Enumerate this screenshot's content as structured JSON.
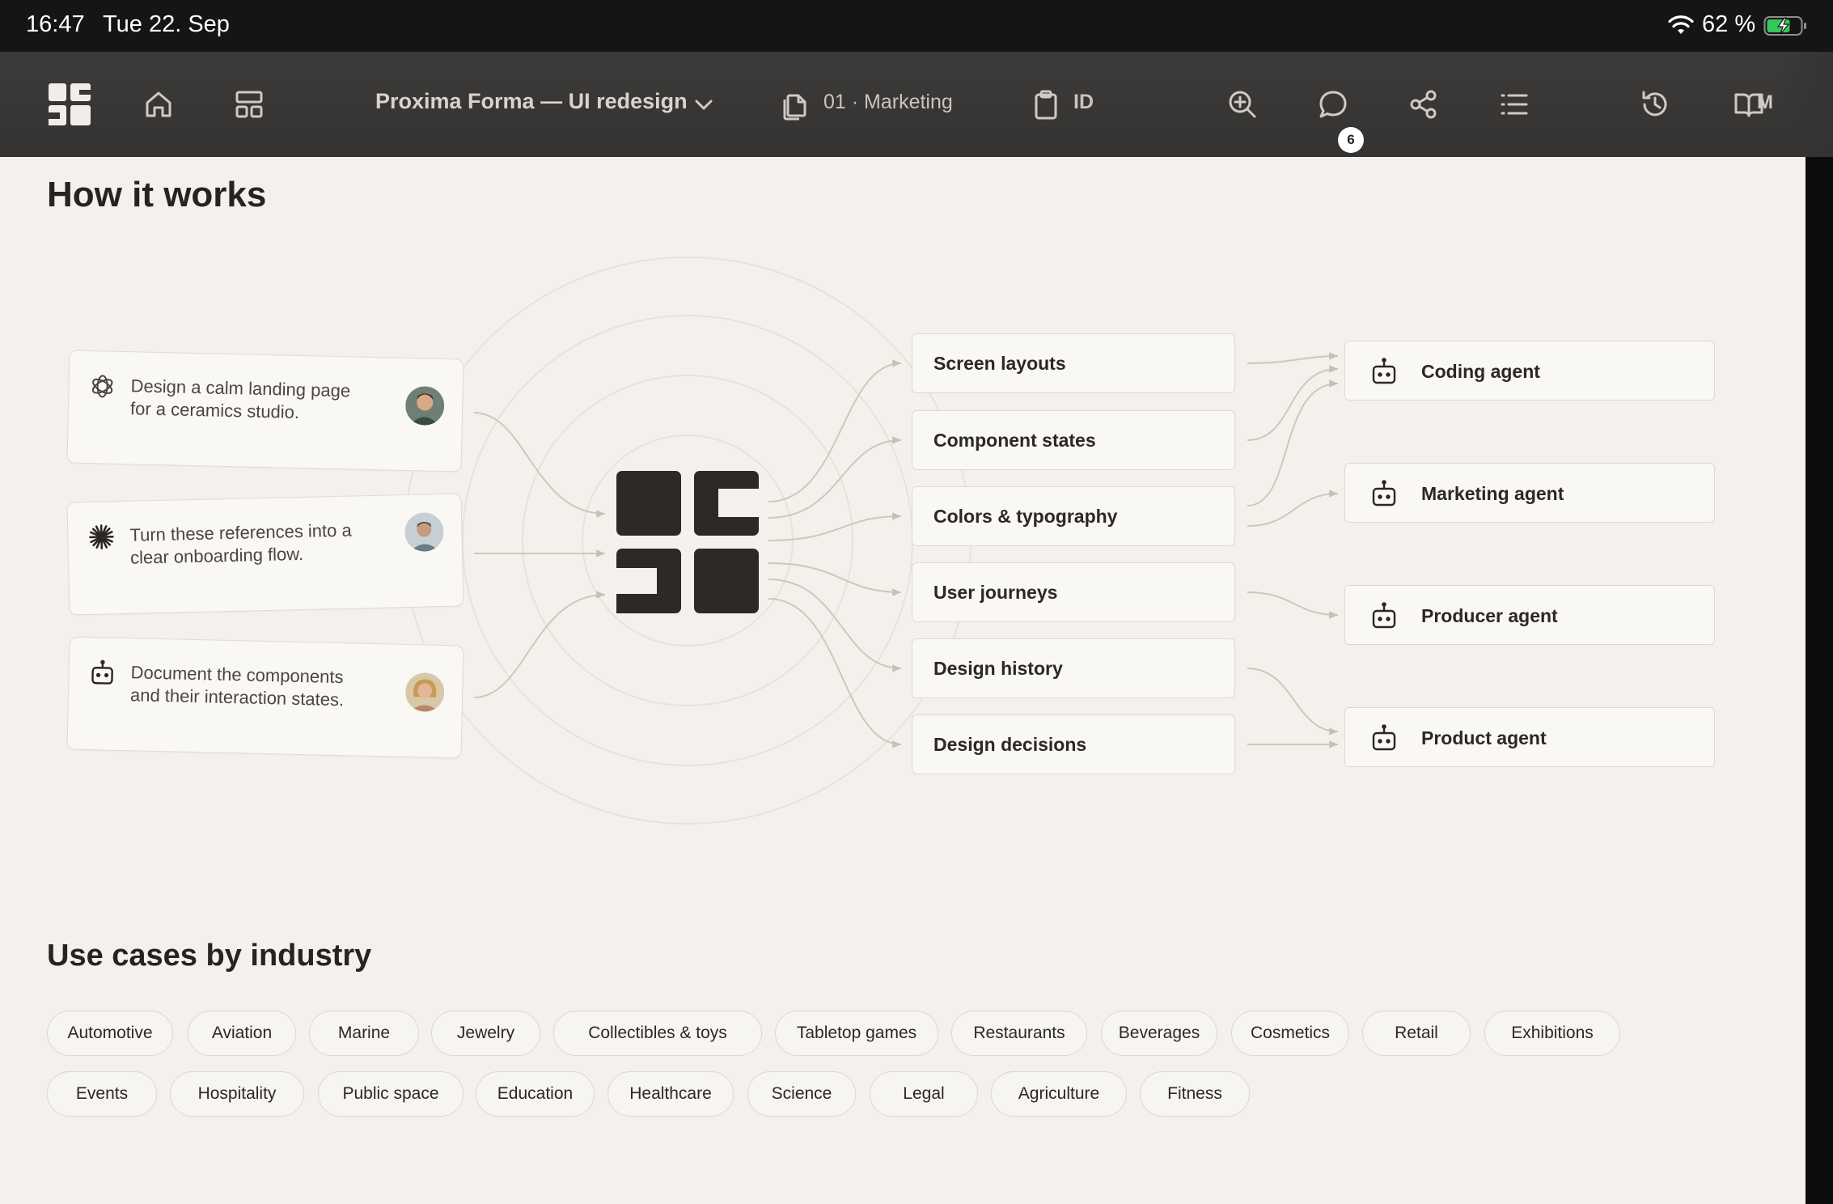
{
  "status_bar": {
    "time": "16:47",
    "date": "Tue 22. Sep",
    "battery_percent": "62 %"
  },
  "toolbar": {
    "project_title": "Proxima Forma — UI redesign",
    "page_label": "01 · Marketing",
    "id_label": "ID",
    "comments_badge": "6",
    "cut_off_label": "M",
    "icons": [
      "app-logo-icon",
      "home-icon",
      "layout-icon",
      "chevron-down-icon",
      "pages-icon",
      "clipboard-icon",
      "zoom-in-icon",
      "comment-icon",
      "share-icon",
      "list-icon",
      "history-icon",
      "book-icon"
    ]
  },
  "how_it_works": {
    "title": "How it works",
    "prompts": [
      {
        "icon": "openai-icon",
        "text": "Design a calm landing page for a ceramics studio."
      },
      {
        "icon": "asterisk-icon",
        "text": "Turn these references into a clear onboarding flow."
      },
      {
        "icon": "robot-icon",
        "text": "Document the components and their interaction states."
      }
    ],
    "outputs": [
      "Screen layouts",
      "Component states",
      "Colors & typography",
      "User journeys",
      "Design history",
      "Design decisions"
    ],
    "agents": [
      "Coding agent",
      "Marketing agent",
      "Producer agent",
      "Product agent"
    ]
  },
  "use_cases": {
    "title": "Use cases by industry",
    "row1": [
      "Automotive",
      "Aviation",
      "Marine",
      "Jewelry",
      "Collectibles & toys",
      "Tabletop games",
      "Restaurants",
      "Beverages",
      "Cosmetics",
      "Retail",
      "Exhibitions"
    ],
    "row2": [
      "Events",
      "Hospitality",
      "Public space",
      "Education",
      "Healthcare",
      "Science",
      "Legal",
      "Agriculture",
      "Fitness"
    ]
  },
  "colors": {
    "background": "#f4f1ec",
    "toolbar": "#3a3836",
    "text": "#2a2725",
    "logo": "#2d2927"
  }
}
